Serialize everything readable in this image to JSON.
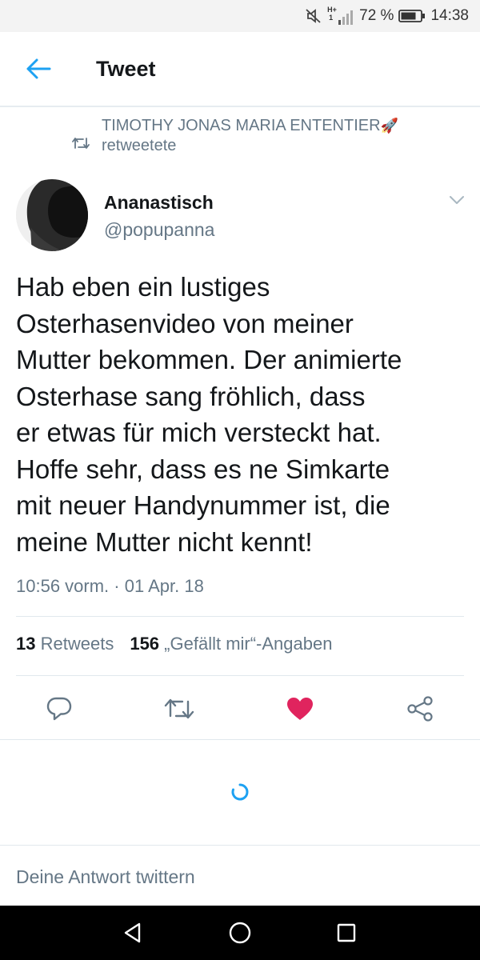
{
  "status_bar": {
    "battery_percent": "72 %",
    "time": "14:38",
    "network_label": "H+",
    "network_sub": "1",
    "icons": [
      "mute-icon",
      "signal-icon",
      "battery-icon"
    ]
  },
  "header": {
    "title": "Tweet",
    "back_icon": "arrow-left-icon"
  },
  "retweet_context": {
    "name": "TIMOTHY JONAS MARIA ENTENTIER",
    "emoji": "🚀",
    "label": "retweetete"
  },
  "author": {
    "name": "Ananastisch",
    "handle": "@popupanna"
  },
  "tweet": {
    "lines": [
      "Hab eben ein lustiges",
      "Osterhasenvideo von meiner",
      "Mutter bekommen. Der animierte",
      "Osterhase sang fröhlich, dass",
      "er etwas für mich versteckt hat.",
      "Hoffe sehr, dass es ne Simkarte",
      "mit neuer Handynummer ist, die",
      "meine Mutter nicht kennt!"
    ],
    "timestamp": "10:56 vorm. · 01 Apr. 18"
  },
  "stats": {
    "retweets_count": "13",
    "retweets_label": "Retweets",
    "likes_count": "156",
    "likes_label": "„Gefällt mir“-Angaben"
  },
  "actions": {
    "items": [
      "reply-icon",
      "retweet-icon",
      "like-icon",
      "share-icon"
    ],
    "liked": true,
    "like_color": "#e0245e",
    "icon_color": "#657786"
  },
  "reply": {
    "placeholder": "Deine Antwort twittern"
  },
  "colors": {
    "accent": "#1da1f2",
    "secondary_text": "#657786",
    "divider": "#e1e8ed"
  }
}
